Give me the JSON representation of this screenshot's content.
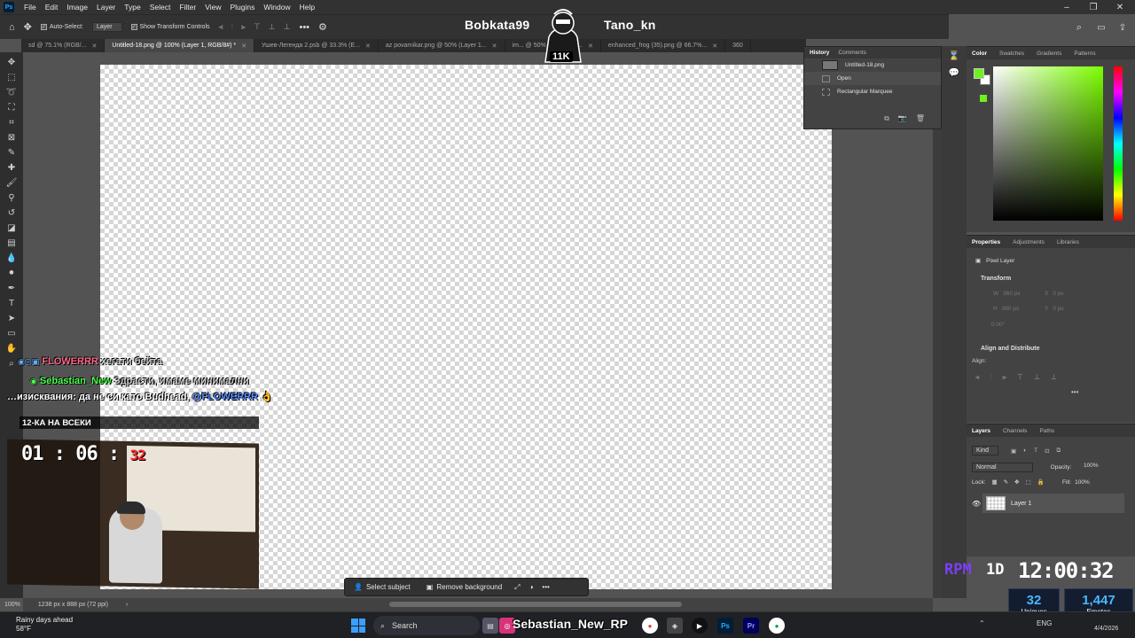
{
  "menu": [
    "File",
    "Edit",
    "Image",
    "Layer",
    "Type",
    "Select",
    "Filter",
    "View",
    "Plugins",
    "Window",
    "Help"
  ],
  "options": {
    "auto_select": "Auto-Select:",
    "layer_select": "Layer",
    "show_transform": "Show Transform Controls",
    "more": "•••"
  },
  "overlay": {
    "left_name": "Bobkata99",
    "right_name": "Tano_kn",
    "badge": "11K"
  },
  "tabs": [
    {
      "label": "sd @ 75.1% (RGB/...",
      "active": false
    },
    {
      "label": "Untitled-18.png @ 100% (Layer 1, RGB/8#) *",
      "active": true
    },
    {
      "label": "Ушев-Легенда 2.psb @ 33.3% (E...",
      "active": false
    },
    {
      "label": "az povarnikar.png @ 50% (Layer 1...",
      "active": false
    },
    {
      "label": "im... @ 50% (Layer 0, L...",
      "active": false
    },
    {
      "label": "enhanced_frog (35).png @ 66.7%...",
      "active": false
    },
    {
      "label": "360",
      "active": false
    }
  ],
  "history": {
    "tabs": [
      "History",
      "Comments"
    ],
    "snapshot": "Untitled-18.png",
    "states": [
      "Open",
      "Rectangular Marquee"
    ]
  },
  "context_bar": {
    "select_subject": "Select subject",
    "remove_background": "Remove background",
    "more": "•••"
  },
  "status": {
    "zoom": "100%",
    "doc_size": "1238 px x 888 px (72 ppi)"
  },
  "color_panel": {
    "tabs": [
      "Color",
      "Swatches",
      "Gradients",
      "Patterns"
    ],
    "foreground": "#6cf21f"
  },
  "properties": {
    "tabs": [
      "Properties",
      "Adjustments",
      "Libraries"
    ],
    "kind": "Pixel Layer",
    "transform_title": "Transform",
    "w_label": "W",
    "h_label": "H",
    "x_label": "X",
    "y_label": "Y",
    "w_val": "360 px",
    "h_val": "360 px",
    "x_val": "0 px",
    "y_val": "0 px",
    "angle": "0.00°",
    "align_title": "Align and Distribute",
    "align_label": "Align:",
    "more": "•••"
  },
  "layers": {
    "tabs": [
      "Layers",
      "Channels",
      "Paths"
    ],
    "kind": "Kind",
    "blend": "Normal",
    "opacity_label": "Opacity:",
    "opacity": "100%",
    "lock_label": "Lock:",
    "fill_label": "Fill:",
    "fill": "100%",
    "layer_name": "Layer 1"
  },
  "chat": [
    {
      "user": "FLOWERRR",
      "msg": "хегати бейта",
      "color": "#ff6a8a"
    },
    {
      "user": "Sebastian_New",
      "msg": "Здрасти, имаме минимални",
      "color": "#4cff4c"
    },
    {
      "msg2": "изисквания: да не си като Budhead,",
      "mention": "@FLOWERRR",
      "emoji": "👌"
    }
  ],
  "banner": "12-КА НА ВСЕКИ",
  "timer": {
    "main": "01 : 06 :",
    "sec": "32"
  },
  "clock": {
    "prefix": "RPM",
    "d": "1D",
    "time": "12:00:32"
  },
  "stats": [
    {
      "value": "32",
      "label": "Uniques"
    },
    {
      "value": "1,447",
      "label": "Emotes"
    }
  ],
  "taskbar": {
    "weather_title": "Rainy days ahead",
    "weather_temp": "58°F",
    "search": "Search",
    "stream_name": "Sebastian_New_RP",
    "lang": "ENG",
    "date": "4/4/2026"
  }
}
